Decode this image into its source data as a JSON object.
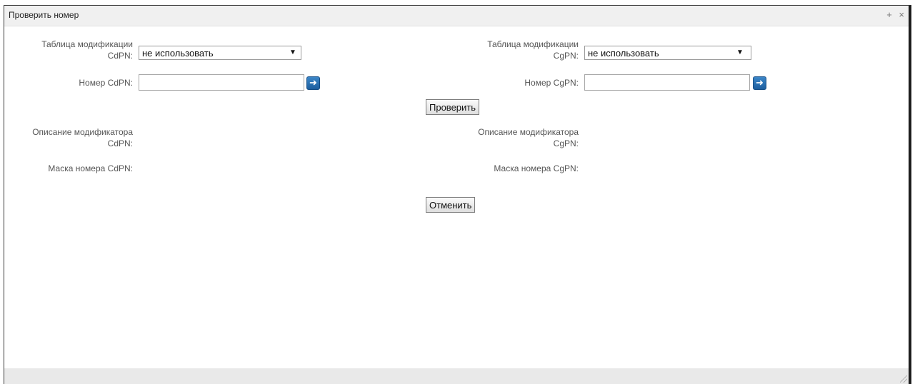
{
  "window": {
    "title": "Проверить номер",
    "icons": {
      "expand": "+",
      "close": "×"
    }
  },
  "cdpn": {
    "table_label": "Таблица модификации CdPN:",
    "table_value": "не использовать",
    "number_label": "Номер CdPN:",
    "number_value": "",
    "desc_label": "Описание модификатора CdPN:",
    "mask_label": "Маска номера CdPN:"
  },
  "cgpn": {
    "table_label": "Таблица модификации CgPN:",
    "table_value": "не использовать",
    "number_label": "Номер CgPN:",
    "number_value": "",
    "desc_label": "Описание модификатора CgPN:",
    "mask_label": "Маска номера CgPN:"
  },
  "buttons": {
    "check": "Проверить",
    "cancel": "Отменить"
  },
  "colors": {
    "go_button": "#2a73b6",
    "titlebar": "#f0f0f0",
    "footer": "#e9e9e9"
  }
}
